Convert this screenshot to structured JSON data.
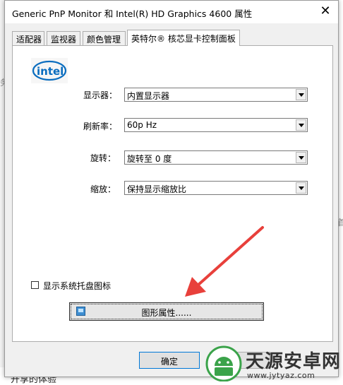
{
  "background": {
    "bottom_text": "开享的体验"
  },
  "dialog": {
    "title": "Generic PnP Monitor 和 Intel(R) HD Graphics 4600 属性",
    "tabs": [
      {
        "label": "适配器",
        "active": false
      },
      {
        "label": "监视器",
        "active": false
      },
      {
        "label": "颜色管理",
        "active": false
      },
      {
        "label": "英特尔® 核芯显卡控制面板",
        "active": true
      }
    ],
    "panel": {
      "logo_text": "intel",
      "fields": [
        {
          "label": "显示器：",
          "value": "内置显示器"
        },
        {
          "label": "刷新率：",
          "value": "60p Hz"
        },
        {
          "label": "旋转：",
          "value": "旋转至 0 度"
        },
        {
          "label": "缩放：",
          "value": "保持显示缩放比"
        }
      ],
      "tray_checkbox": {
        "label": "显示系统托盘图标",
        "checked": false
      },
      "graphics_button": "图形属性......"
    },
    "ok_button": "确定"
  },
  "annotation": {
    "arrow_color": "#e8403b"
  },
  "watermark": {
    "name": "天源安卓网",
    "url": "www.jytyaz.com"
  },
  "colors": {
    "intel_blue": "#0a6dbf",
    "focus_border": "#0078d7"
  }
}
